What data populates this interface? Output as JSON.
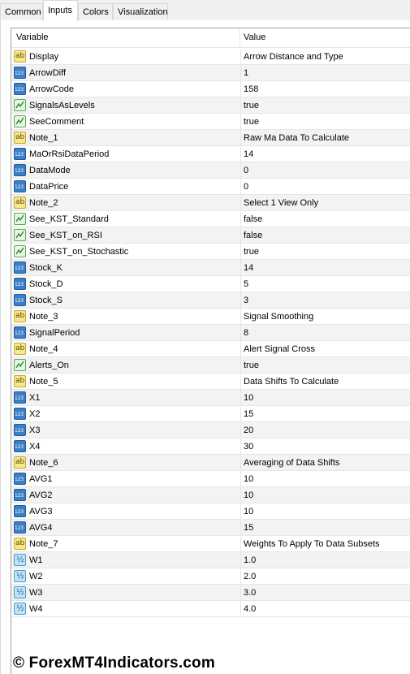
{
  "tabs": [
    {
      "label": "Common",
      "active": false
    },
    {
      "label": "Inputs",
      "active": true
    },
    {
      "label": "Colors",
      "active": false
    },
    {
      "label": "Visualization",
      "active": false
    }
  ],
  "grid": {
    "col_variable": "Variable",
    "col_value": "Value",
    "rows": [
      {
        "type": "string",
        "name": "Display",
        "value": "Arrow Distance and Type"
      },
      {
        "type": "int",
        "name": "ArrowDiff",
        "value": "1"
      },
      {
        "type": "int",
        "name": "ArrowCode",
        "value": "158"
      },
      {
        "type": "bool",
        "name": "SignalsAsLevels",
        "value": "true"
      },
      {
        "type": "bool",
        "name": "SeeComment",
        "value": "true"
      },
      {
        "type": "string",
        "name": "Note_1",
        "value": "Raw Ma Data To Calculate"
      },
      {
        "type": "int",
        "name": "MaOrRsiDataPeriod",
        "value": "14"
      },
      {
        "type": "int",
        "name": "DataMode",
        "value": "0"
      },
      {
        "type": "int",
        "name": "DataPrice",
        "value": "0"
      },
      {
        "type": "string",
        "name": "Note_2",
        "value": "Select 1 View Only"
      },
      {
        "type": "bool",
        "name": "See_KST_Standard",
        "value": "false"
      },
      {
        "type": "bool",
        "name": "See_KST_on_RSI",
        "value": "false"
      },
      {
        "type": "bool",
        "name": "See_KST_on_Stochastic",
        "value": "true"
      },
      {
        "type": "int",
        "name": "Stock_K",
        "value": "14"
      },
      {
        "type": "int",
        "name": "Stock_D",
        "value": "5"
      },
      {
        "type": "int",
        "name": "Stock_S",
        "value": "3"
      },
      {
        "type": "string",
        "name": "Note_3",
        "value": "Signal Smoothing"
      },
      {
        "type": "int",
        "name": "SignalPeriod",
        "value": "8"
      },
      {
        "type": "string",
        "name": "Note_4",
        "value": "Alert Signal Cross"
      },
      {
        "type": "bool",
        "name": "Alerts_On",
        "value": "true"
      },
      {
        "type": "string",
        "name": "Note_5",
        "value": "Data Shifts To Calculate"
      },
      {
        "type": "int",
        "name": "X1",
        "value": "10"
      },
      {
        "type": "int",
        "name": "X2",
        "value": "15"
      },
      {
        "type": "int",
        "name": "X3",
        "value": "20"
      },
      {
        "type": "int",
        "name": "X4",
        "value": "30"
      },
      {
        "type": "string",
        "name": "Note_6",
        "value": "Averaging of Data Shifts"
      },
      {
        "type": "int",
        "name": "AVG1",
        "value": "10"
      },
      {
        "type": "int",
        "name": "AVG2",
        "value": "10"
      },
      {
        "type": "int",
        "name": "AVG3",
        "value": "10"
      },
      {
        "type": "int",
        "name": "AVG4",
        "value": "15"
      },
      {
        "type": "string",
        "name": "Note_7",
        "value": "Weights To Apply To Data Subsets"
      },
      {
        "type": "double",
        "name": "W1",
        "value": "1.0"
      },
      {
        "type": "double",
        "name": "W2",
        "value": "2.0"
      },
      {
        "type": "double",
        "name": "W3",
        "value": "3.0"
      },
      {
        "type": "double",
        "name": "W4",
        "value": "4.0"
      }
    ]
  },
  "icons": {
    "string": "string-type-icon",
    "int": "integer-type-icon",
    "bool": "boolean-type-icon",
    "double": "double-type-icon"
  },
  "watermark": "© ForexMT4Indicators.com"
}
